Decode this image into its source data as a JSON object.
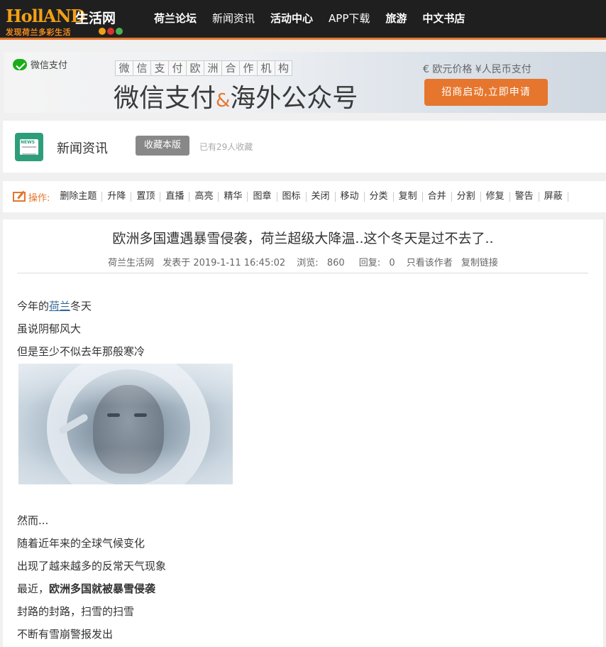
{
  "logo": {
    "brand": "HollAND",
    "brand_cn": "生活网",
    "slogan": "发现荷兰多彩生活"
  },
  "nav": [
    {
      "label": "荷兰论坛",
      "bold": true
    },
    {
      "label": "新闻资讯",
      "bold": false
    },
    {
      "label": "活动中心",
      "bold": true
    },
    {
      "label": "APP下载",
      "bold": false
    },
    {
      "label": "旅游",
      "bold": true
    },
    {
      "label": "中文书店",
      "bold": true
    }
  ],
  "banner": {
    "wechat_pay": "微信支付",
    "chars": [
      "微",
      "信",
      "支",
      "付",
      "欧",
      "洲",
      "合",
      "作",
      "机",
      "构"
    ],
    "headline_a": "微信支付",
    "headline_amp": "&",
    "headline_b": "海外公众号",
    "price": "€ 欧元价格 ¥人民币支付",
    "apply_label": "招商启动,立即申请"
  },
  "section": {
    "title": "新闻资讯",
    "favorite_label": "收藏本版",
    "favorite_count": "已有29人收藏"
  },
  "ops": {
    "label": "操作:",
    "items": [
      "删除主题",
      "升降",
      "置顶",
      "直播",
      "高亮",
      "精华",
      "图章",
      "图标",
      "关闭",
      "移动",
      "分类",
      "复制",
      "合并",
      "分割",
      "修复",
      "警告",
      "屏蔽"
    ]
  },
  "article": {
    "title": "欧洲多国遭遇暴雪侵袭，荷兰超级大降温..这个冬天是过不去了..",
    "meta": {
      "author": "荷兰生活网",
      "posted": "发表于 2019-1-11 16:45:02",
      "views_label": "浏览:",
      "views": "860",
      "replies_label": "回复:",
      "replies": "0",
      "author_only": "只看该作者",
      "copy_link": "复制链接"
    },
    "p1_pre": "今年的",
    "p1_link": "荷兰",
    "p1_post": "冬天",
    "p2": "虽说阴郁风大",
    "p3": "但是至少不似去年那般寒冷",
    "p4": "然而...",
    "p5": "随着近年来的全球气候变化",
    "p6": "出现了越来越多的反常天气现象",
    "p7_pre": "最近，",
    "p7_bold": "欧洲多国就被暴雪侵袭",
    "p8": "封路的封路，扫雪的扫雪",
    "p9": "不断有雪崩警报发出"
  },
  "colors": {
    "accent": "#e6762d",
    "nav_bg": "#1f1f1f",
    "link": "#336699",
    "news_icon": "#2e9e7a"
  }
}
